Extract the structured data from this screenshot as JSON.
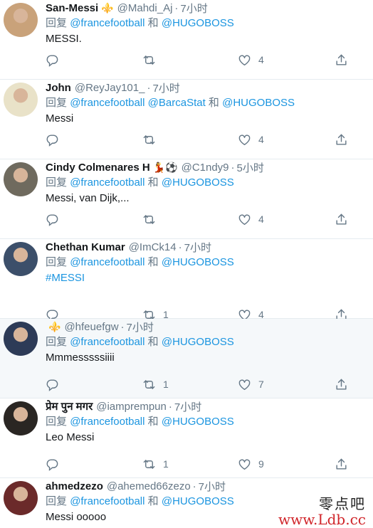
{
  "reply_prefix": "回复",
  "and_word": "和",
  "tweets": [
    {
      "name": "San-Messi",
      "emoji": "⚜️",
      "handle": "@Mahdi_Aj",
      "time": "7小时",
      "mentions": [
        "@francefootball",
        "@HUGOBOSS"
      ],
      "text": [
        "MESSI."
      ],
      "retweets": "",
      "likes": "4",
      "avatar_color": "#c9a27a"
    },
    {
      "name": "John",
      "emoji": "",
      "handle": "@ReyJay101_",
      "time": "7小时",
      "mentions": [
        "@francefootball",
        "@BarcaStat",
        "@HUGOBOSS"
      ],
      "text": [
        "Messi"
      ],
      "retweets": "",
      "likes": "4",
      "avatar_color": "#e9e2c8"
    },
    {
      "name": "Cindy Colmenares H",
      "emoji": "💃⚽",
      "handle": "@C1ndy9",
      "time": "5小时",
      "mentions": [
        "@francefootball",
        "@HUGOBOSS"
      ],
      "text": [
        "Messi, van Dijk,..."
      ],
      "retweets": "",
      "likes": "4",
      "avatar_color": "#6f6a5e"
    },
    {
      "name": "Chethan Kumar",
      "emoji": "",
      "handle": "@ImCk14",
      "time": "7小时",
      "mentions": [
        "@francefootball",
        "@HUGOBOSS"
      ],
      "text": [
        "#MESSI"
      ],
      "retweets": "1",
      "likes": "4",
      "avatar_color": "#3c4f6a"
    },
    {
      "name": "",
      "emoji": "⚜️",
      "handle": "@hfeuefgw",
      "time": "7小时",
      "mentions": [
        "@francefootball",
        "@HUGOBOSS"
      ],
      "text": [
        "Mmmesssssiiii"
      ],
      "retweets": "1",
      "likes": "7",
      "avatar_color": "#2d3b57"
    },
    {
      "name": "प्रेम पुन मगर",
      "emoji": "",
      "handle": "@iamprempun",
      "time": "7小时",
      "mentions": [
        "@francefootball",
        "@HUGOBOSS"
      ],
      "text": [
        "Leo Messi"
      ],
      "retweets": "1",
      "likes": "9",
      "avatar_color": "#2a2623"
    },
    {
      "name": "ahmedzezo",
      "emoji": "",
      "handle": "@ahemed66zezo",
      "time": "7小时",
      "mentions": [
        "@francefootball",
        "@HUGOBOSS"
      ],
      "text": [
        "Messi ooooo"
      ],
      "retweets": "",
      "likes": "",
      "avatar_color": "#6b2a2a"
    }
  ],
  "watermark": {
    "cn": "零点吧",
    "url": "www.Ldb.cc"
  }
}
